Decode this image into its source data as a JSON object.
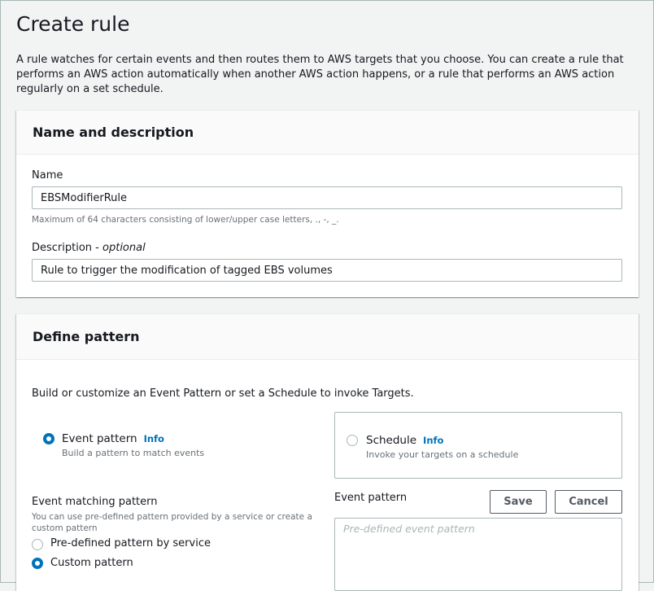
{
  "page": {
    "title": "Create rule",
    "intro": "A rule watches for certain events and then routes them to AWS targets that you choose. You can create a rule that performs an AWS action automatically when another AWS action happens, or a rule that performs an AWS action regularly on a set schedule."
  },
  "name_panel": {
    "title": "Name and description",
    "name_label": "Name",
    "name_value": "EBSModifierRule",
    "name_hint": "Maximum of 64 characters consisting of lower/upper case letters, ., -, _.",
    "description_label": "Description",
    "description_optional": "optional",
    "description_separator": " - ",
    "description_value": "Rule to trigger the modification of tagged EBS volumes"
  },
  "pattern_panel": {
    "title": "Define pattern",
    "intro": "Build or customize an Event Pattern or set a Schedule to invoke Targets.",
    "info_label": "Info",
    "event_pattern_option": {
      "title": "Event pattern",
      "description": "Build a pattern to match events",
      "selected": true
    },
    "schedule_option": {
      "title": "Schedule",
      "description": "Invoke your targets on a schedule",
      "selected": false
    },
    "matching": {
      "label": "Event matching pattern",
      "hint": "You can use pre-defined pattern provided by a service or create a custom pattern",
      "options": [
        {
          "label": "Pre-defined pattern by service",
          "selected": false
        },
        {
          "label": "Custom pattern",
          "selected": true
        }
      ]
    },
    "editor": {
      "label": "Event pattern",
      "save_label": "Save",
      "cancel_label": "Cancel",
      "placeholder": "Pre-defined event pattern"
    }
  },
  "colors": {
    "accent": "#0073bb",
    "border": "#aab7b8",
    "text": "#16191f",
    "muted": "#687078",
    "background": "#f2f3f3"
  }
}
